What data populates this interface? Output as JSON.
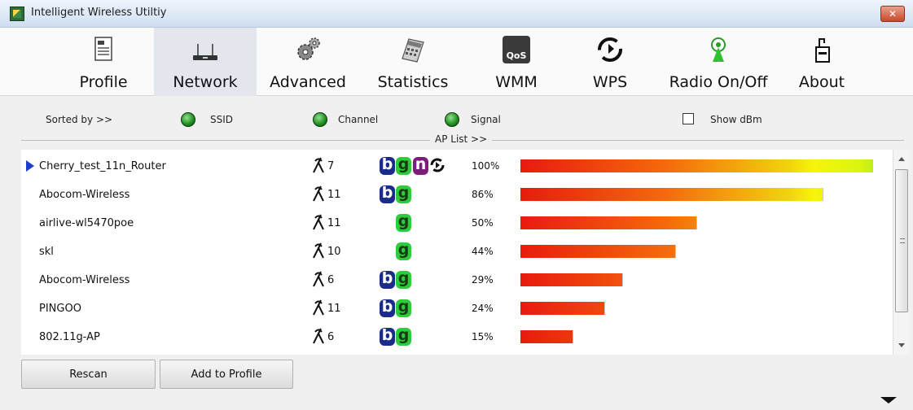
{
  "window": {
    "title": "Intelligent Wireless Utiltiy",
    "close": "✕"
  },
  "toolbar": {
    "items": [
      {
        "label": "Profile"
      },
      {
        "label": "Network"
      },
      {
        "label": "Advanced"
      },
      {
        "label": "Statistics"
      },
      {
        "label": "WMM"
      },
      {
        "label": "WPS"
      },
      {
        "label": "Radio On/Off"
      },
      {
        "label": "About"
      }
    ],
    "wmm_icon_text": "QoS"
  },
  "sort": {
    "label": "Sorted by >>",
    "ssid": "SSID",
    "channel": "Channel",
    "signal": "Signal",
    "show_dbm": "Show dBm"
  },
  "ap_list": {
    "caption": "AP List >>",
    "rows": [
      {
        "ssid": "Cherry_test_11n_Router",
        "channel": "7",
        "b": "b",
        "g": "g",
        "n": "n",
        "wps": true,
        "signal": "100%",
        "level": 100
      },
      {
        "ssid": "Abocom-Wireless",
        "channel": "11",
        "b": "b",
        "g": "g",
        "n": "",
        "wps": false,
        "signal": "86%",
        "level": 86
      },
      {
        "ssid": "airlive-wl5470poe",
        "channel": "11",
        "b": "",
        "g": "g",
        "n": "",
        "wps": false,
        "signal": "50%",
        "level": 50
      },
      {
        "ssid": "skl",
        "channel": "10",
        "b": "",
        "g": "g",
        "n": "",
        "wps": false,
        "signal": "44%",
        "level": 44
      },
      {
        "ssid": "Abocom-Wireless",
        "channel": "6",
        "b": "b",
        "g": "g",
        "n": "",
        "wps": false,
        "signal": "29%",
        "level": 29
      },
      {
        "ssid": "PINGOO",
        "channel": "11",
        "b": "b",
        "g": "g",
        "n": "",
        "wps": false,
        "signal": "24%",
        "level": 24
      },
      {
        "ssid": "802.11g-AP",
        "channel": "6",
        "b": "b",
        "g": "g",
        "n": "",
        "wps": false,
        "signal": "15%",
        "level": 15
      }
    ]
  },
  "buttons": {
    "rescan": "Rescan",
    "add_to_profile": "Add to Profile"
  }
}
